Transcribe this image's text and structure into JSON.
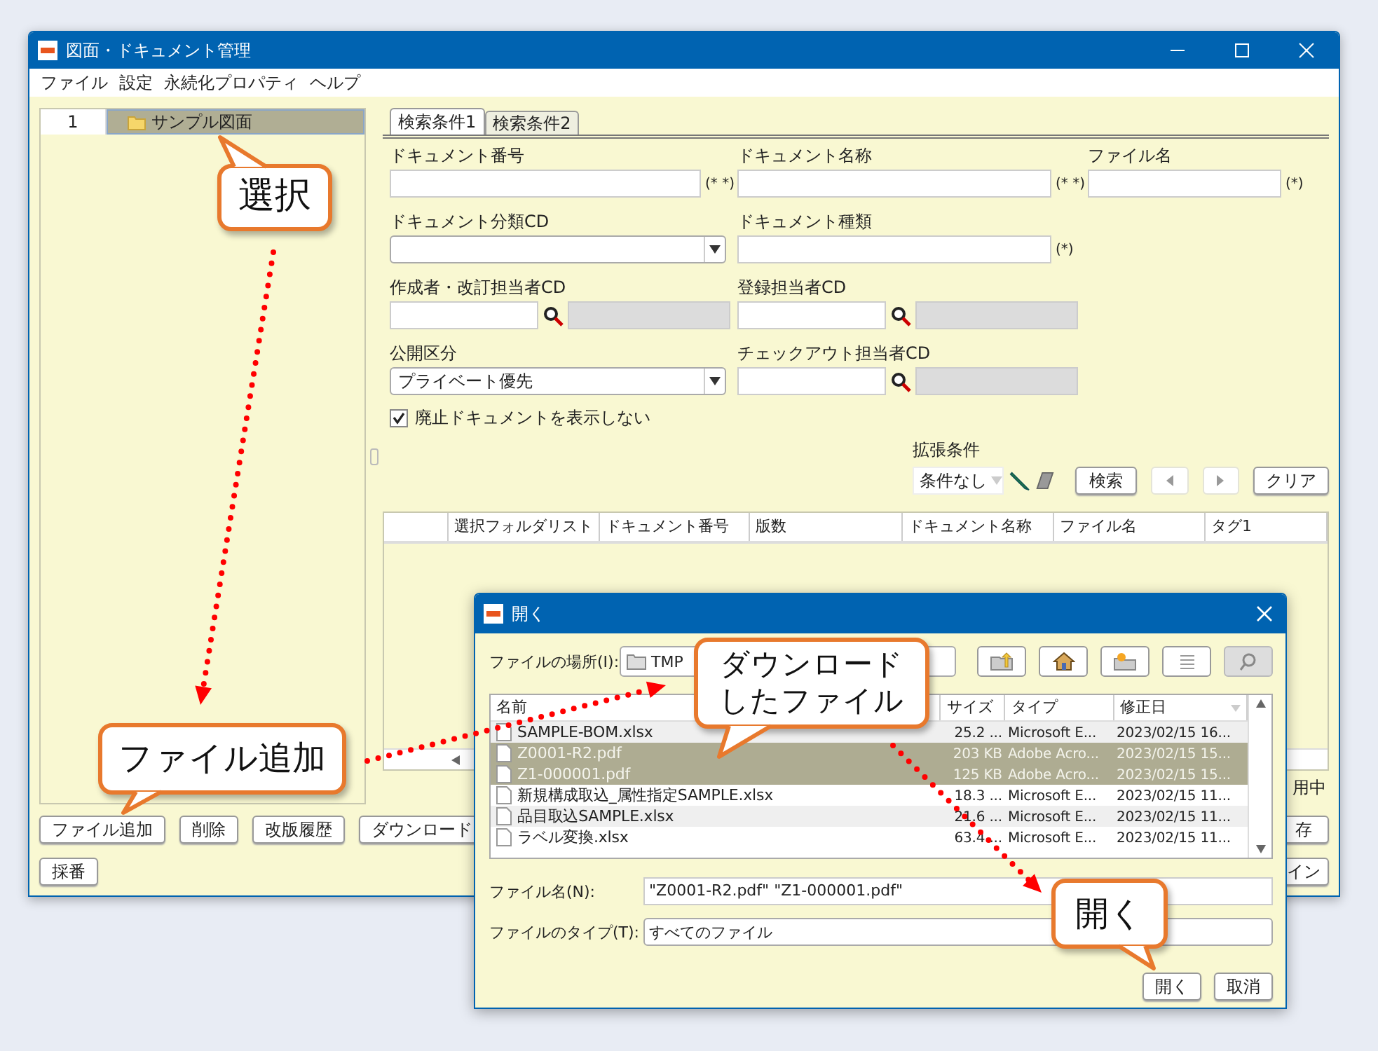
{
  "main_window": {
    "title": "図面・ドキュメント管理",
    "menu": [
      "ファイル",
      "設定",
      "永続化プロパティ",
      "ヘルプ"
    ],
    "tree": {
      "row_number": "1",
      "items": [
        {
          "label": "サンプル図面",
          "selected": true
        }
      ]
    },
    "tabs": [
      {
        "label": "検索条件1",
        "selected": true
      },
      {
        "label": "検索条件2",
        "selected": false
      }
    ],
    "form_rows": [
      [
        {
          "kind": "text",
          "label": "ドキュメント番号",
          "note": "(* *)"
        },
        {
          "kind": "text",
          "label": "ドキュメント名称",
          "note": "(* *)"
        },
        {
          "kind": "text",
          "label": "ファイル名",
          "note": "(*)"
        }
      ],
      [
        {
          "kind": "select",
          "label": "ドキュメント分類CD"
        },
        {
          "kind": "text",
          "label": "ドキュメント種類",
          "note": "(*)"
        }
      ],
      [
        {
          "kind": "lookup",
          "label": "作成者・改訂担当者CD"
        },
        {
          "kind": "lookup",
          "label": "登録担当者CD"
        }
      ],
      [
        {
          "kind": "select",
          "label": "公開区分",
          "value": "プライベート優先"
        },
        {
          "kind": "lookup",
          "label": "チェックアウト担当者CD"
        }
      ]
    ],
    "hide_obsolete": {
      "label": "廃止ドキュメントを表示しない",
      "checked": true
    },
    "extended_conditions": {
      "label": "拡張条件",
      "value": "条件なし"
    },
    "search_buttons": [
      {
        "kind": "text",
        "label": "検索",
        "disabled": false
      },
      {
        "kind": "prev",
        "disabled": true
      },
      {
        "kind": "next",
        "disabled": true
      },
      {
        "kind": "text",
        "label": "クリア",
        "disabled": false
      }
    ],
    "results_columns": [
      "選択フォルダリスト",
      "ドキュメント番号",
      "版数",
      "ドキュメント名称",
      "ファイル名",
      "タグ1"
    ],
    "status_text": "用中",
    "action_rows": [
      {
        "left": [
          "ファイル追加",
          "削除",
          "改版履歴",
          "ダウンロード"
        ],
        "right": "存"
      },
      {
        "left": [
          "採番"
        ],
        "right": "イン"
      }
    ]
  },
  "dialog": {
    "title": "開く",
    "location_label": "ファイルの場所(I):",
    "location": "TMP",
    "view_buttons": [
      {
        "kind": "list",
        "selected": false
      },
      {
        "kind": "details",
        "selected": true
      }
    ],
    "columns": [
      "名前",
      "サイズ",
      "タイプ",
      "修正日"
    ],
    "files": [
      {
        "name": "SAMPLE-BOM.xlsx",
        "size": "25.2 ...",
        "type": "Microsoft E...",
        "modified": "2023/02/15 16...",
        "selected": false
      },
      {
        "name": "Z0001-R2.pdf",
        "size": "203 KB",
        "type": "Adobe Acro...",
        "modified": "2023/02/15 15...",
        "selected": true
      },
      {
        "name": "Z1-000001.pdf",
        "size": "125 KB",
        "type": "Adobe Acro...",
        "modified": "2023/02/15 15...",
        "selected": true
      },
      {
        "name": "新規構成取込_属性指定SAMPLE.xlsx",
        "size": "18.3 ...",
        "type": "Microsoft E...",
        "modified": "2023/02/15 11...",
        "selected": false
      },
      {
        "name": "品目取込SAMPLE.xlsx",
        "size": "21.6 ...",
        "type": "Microsoft E...",
        "modified": "2023/02/15 11...",
        "selected": false
      },
      {
        "name": "ラベル変換.xlsx",
        "size": "63.4 ...",
        "type": "Microsoft E...",
        "modified": "2023/02/15 11...",
        "selected": false
      }
    ],
    "file_name_label": "ファイル名(N):",
    "file_name": "\"Z0001-R2.pdf\" \"Z1-000001.pdf\"",
    "file_type_label": "ファイルのタイプ(T):",
    "file_type": "すべてのファイル",
    "buttons": [
      "開く",
      "取消"
    ]
  },
  "callouts": [
    "選択",
    "ファイル追加",
    "ダウンロードしたファイル",
    "開く"
  ]
}
